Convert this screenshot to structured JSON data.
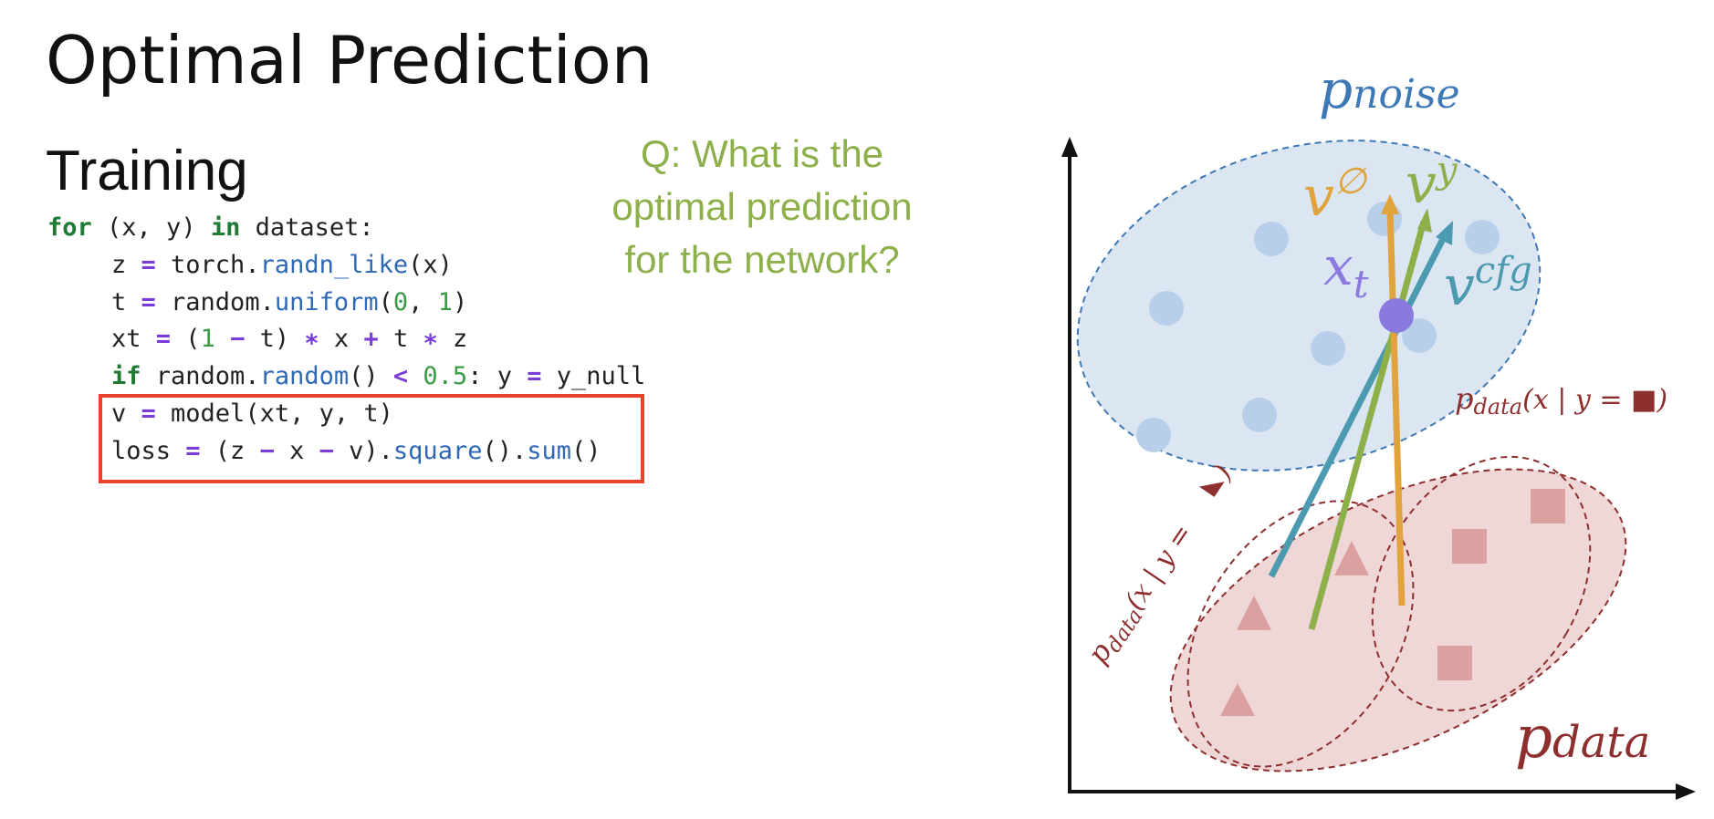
{
  "slide": {
    "title": "Optimal Prediction"
  },
  "training": {
    "heading": "Training"
  },
  "question": {
    "line1": "Q: What is the",
    "line2": "optimal prediction",
    "line3": "for the network?"
  },
  "code": {
    "l1": {
      "for": "for",
      "vars": " (x, y) ",
      "in": "in",
      "rest": " dataset:"
    },
    "l2": {
      "a": "z ",
      "eq": "=",
      "b": " torch.",
      "fn": "randn_like",
      "c": "(x)"
    },
    "l3": {
      "a": "t ",
      "eq": "=",
      "b": " random.",
      "fn": "uniform",
      "c": "(",
      "n1": "0",
      "d": ", ",
      "n2": "1",
      "e": ")"
    },
    "l4": {
      "a": "xt ",
      "eq": "=",
      "b": " (",
      "n1": "1",
      "c": " ",
      "minus": "−",
      "d": " t) ",
      "mul1": "∗",
      "e": " x ",
      "plus": "+",
      "f": " t ",
      "mul2": "∗",
      "g": " z"
    },
    "l5": {
      "if": "if",
      "a": " random.",
      "fn": "random",
      "b": "() ",
      "lt": "<",
      "c": " ",
      "n": "0.5",
      "d": ": y ",
      "eq": "=",
      "e": " y_null"
    },
    "l6": {
      "a": "v ",
      "eq": "=",
      "b": " model(xt, y, t)"
    },
    "l7": {
      "a": "loss ",
      "eq": "=",
      "b": " (z ",
      "m1": "−",
      "c": " x ",
      "m2": "−",
      "d": " v).",
      "fn1": "square",
      "e": "().",
      "fn2": "sum",
      "f": "()"
    }
  },
  "diagram": {
    "colors": {
      "noise_fill": "#dbe6f2",
      "noise_stroke": "#3f79b5",
      "noise_dot": "#b7cfe8",
      "data_fill": "#f0d7d7",
      "data_stroke": "#8e2f2f",
      "data_marker": "#dba0a0",
      "v_null": "#e0a33d",
      "v_y": "#8db04a",
      "v_cfg": "#4b9ab0",
      "xt": "#8a7ae0"
    },
    "icons": {
      "triangle": "triangle-marker",
      "square": "square-marker"
    },
    "p_noise": {
      "p": "p",
      "sub": "noise"
    },
    "v_null": {
      "v": "v",
      "sup": "∅"
    },
    "v_y": {
      "v": "v",
      "sup": "y"
    },
    "v_cfg": {
      "v": "v",
      "sup": "cfg"
    },
    "x_t": {
      "x": "x",
      "sub": "t"
    },
    "p_data_square": {
      "p": "p",
      "sub": "data",
      "expr": "(x | y = ■)"
    },
    "p_data_triangle": {
      "p": "p",
      "sub": "data",
      "expr": "(x | y =",
      "close": ")"
    },
    "p_data": {
      "p": "p",
      "sub": "data"
    }
  }
}
